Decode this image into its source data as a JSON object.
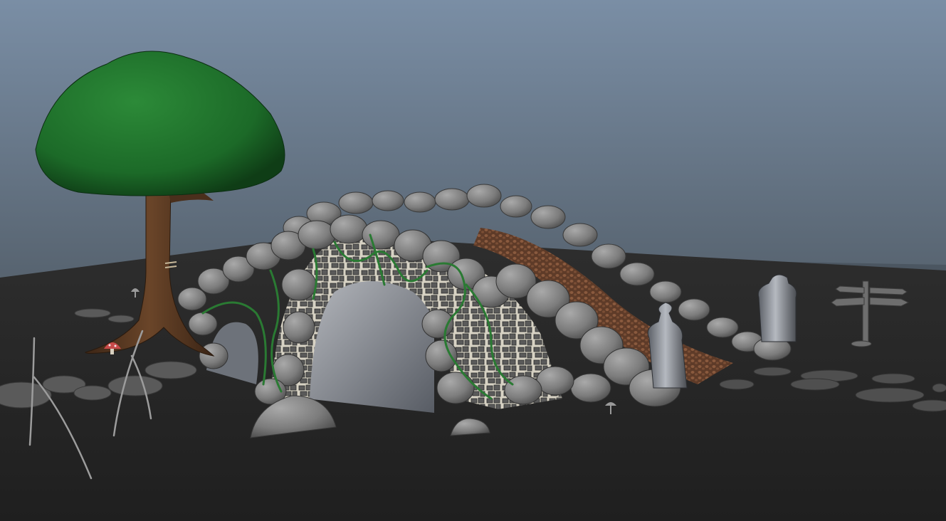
{
  "app": {
    "view": "3d-viewport",
    "background_top": "#7d91a8",
    "background_bottom": "#3a434d"
  },
  "scene": {
    "objects": [
      "tree",
      "stone-bridge",
      "cobblestone-path",
      "vines",
      "stepping-stones",
      "lantern-posts",
      "signpost",
      "mushroom",
      "reeds",
      "boulders"
    ],
    "colors": {
      "ground": "#2a2a2a",
      "foliage": "#1e6b2a",
      "trunk": "#5b3a22",
      "stone": "#8a8a8a",
      "vine": "#2f8a3a",
      "mushroom_cap": "#c84a4a",
      "cobble": "#6b4632"
    }
  }
}
